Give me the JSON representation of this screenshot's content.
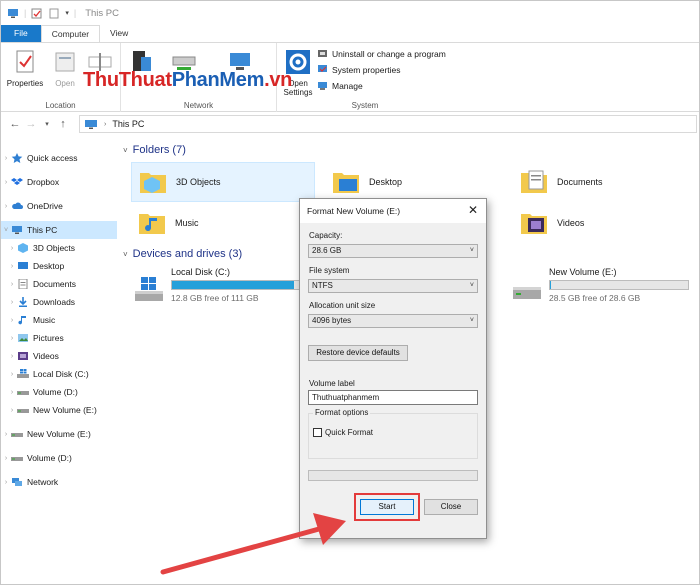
{
  "window": {
    "title": "This PC"
  },
  "ribbon": {
    "tabs": [
      "File",
      "Computer",
      "View"
    ],
    "buttons": {
      "properties": "Properties",
      "open": "Open",
      "open_settings_1": "Open",
      "open_settings_2": "Settings"
    },
    "system_items": [
      "Uninstall or change a program",
      "System properties",
      "Manage"
    ],
    "groups": {
      "location": "Location",
      "network": "Network",
      "system": "System"
    }
  },
  "watermark": {
    "part1": "ThuThuat",
    "part2": "PhanMem",
    "part3": ".vn"
  },
  "address": {
    "path": "This PC"
  },
  "nav": {
    "items": [
      "Quick access",
      "Dropbox",
      "OneDrive",
      "This PC",
      "3D Objects",
      "Desktop",
      "Documents",
      "Downloads",
      "Music",
      "Pictures",
      "Videos",
      "Local Disk (C:)",
      "Volume (D:)",
      "New Volume (E:)",
      "New Volume (E:)",
      "Volume (D:)",
      "Network"
    ]
  },
  "content": {
    "folders_heading": "Folders (7)",
    "folders": [
      "3D Objects",
      "Desktop",
      "Documents",
      "Music",
      "Videos"
    ],
    "drives_heading": "Devices and drives (3)",
    "drives": [
      {
        "name": "Local Disk (C:)",
        "free": "12.8 GB free of 111 GB",
        "used_fraction": 0.885
      },
      {
        "name": "New Volume (E:)",
        "free": "28.5 GB free of 28.6 GB",
        "used_fraction": 0.004
      }
    ]
  },
  "dialog": {
    "title": "Format New Volume (E:)",
    "close_glyph": "✕",
    "capacity_label": "Capacity:",
    "capacity_value": "28.6 GB",
    "fs_label": "File system",
    "fs_value": "NTFS",
    "alloc_label": "Allocation unit size",
    "alloc_value": "4096 bytes",
    "restore_label": "Restore device defaults",
    "volume_label": "Volume label",
    "volume_value": "Thuthuatphanmem",
    "format_options": "Format options",
    "quick_format": "Quick Format",
    "start": "Start",
    "close": "Close"
  },
  "colors": {
    "accent": "#1979ca",
    "drive_fill": "#26a0da",
    "highlight": "#e33b3b"
  }
}
